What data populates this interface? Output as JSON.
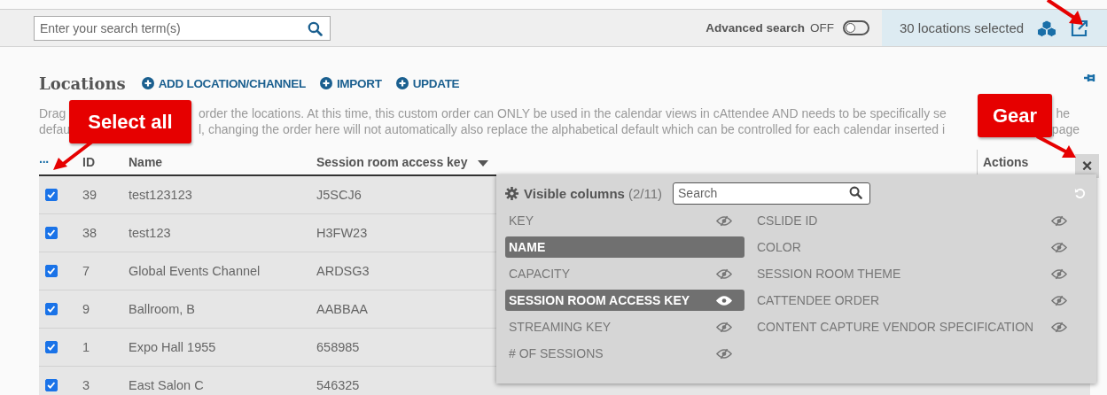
{
  "search": {
    "placeholder": "Enter your search term(s)"
  },
  "advanced_search": {
    "label": "Advanced search",
    "state_text": "OFF",
    "on": false
  },
  "selection": {
    "count": "30",
    "text": "locations selected"
  },
  "heading": {
    "title": "Locations",
    "actions": [
      "ADD LOCATION/CHANNEL",
      "IMPORT",
      "UPDATE"
    ]
  },
  "description": {
    "lines": [
      [
        "Drag",
        "order the locations. At this time, this custom order can ONLY be used in the calendar views in cAttendee AND needs to be specifically se",
        "he"
      ],
      [
        "defau",
        "l, changing the order here will not automatically also replace the alphabetical default which can be controlled for each calendar inserted i",
        "page"
      ]
    ]
  },
  "table": {
    "select_all": "···",
    "columns": [
      "ID",
      "Name",
      "Session room access key",
      "Actions"
    ],
    "close": "×",
    "rows": [
      {
        "checked": true,
        "id": "39",
        "name": "test123123",
        "key": "J5SCJ6"
      },
      {
        "checked": true,
        "id": "38",
        "name": "test123",
        "key": "H3FW23"
      },
      {
        "checked": true,
        "id": "7",
        "name": "Global Events Channel",
        "key": "ARDSG3"
      },
      {
        "checked": true,
        "id": "9",
        "name": "Ballroom, B",
        "key": "AABBAA"
      },
      {
        "checked": true,
        "id": "1",
        "name": "Expo Hall 1955",
        "key": "658985"
      },
      {
        "checked": true,
        "id": "3",
        "name": "East Salon C",
        "key": "546325"
      }
    ]
  },
  "column_picker": {
    "title": "Visible columns",
    "count": "(2/11)",
    "search_placeholder": "Search",
    "left": [
      {
        "label": "KEY",
        "visible": false,
        "locked": false
      },
      {
        "label": "NAME",
        "visible": true,
        "locked": true
      },
      {
        "label": "CAPACITY",
        "visible": false,
        "locked": false
      },
      {
        "label": "SESSION ROOM ACCESS KEY",
        "visible": true,
        "locked": false
      },
      {
        "label": "STREAMING KEY",
        "visible": false,
        "locked": false
      },
      {
        "label": "# OF SESSIONS",
        "visible": false,
        "locked": false
      }
    ],
    "right": [
      {
        "label": "CSLIDE ID",
        "visible": false,
        "locked": false
      },
      {
        "label": "COLOR",
        "visible": false,
        "locked": false
      },
      {
        "label": "SESSION ROOM THEME",
        "visible": false,
        "locked": false
      },
      {
        "label": "CATTENDEE ORDER",
        "visible": false,
        "locked": false
      },
      {
        "label": "CONTENT CAPTURE VENDOR SPECIFICATION",
        "visible": false,
        "locked": false
      }
    ]
  },
  "callouts": [
    "Select all",
    "Gear"
  ]
}
